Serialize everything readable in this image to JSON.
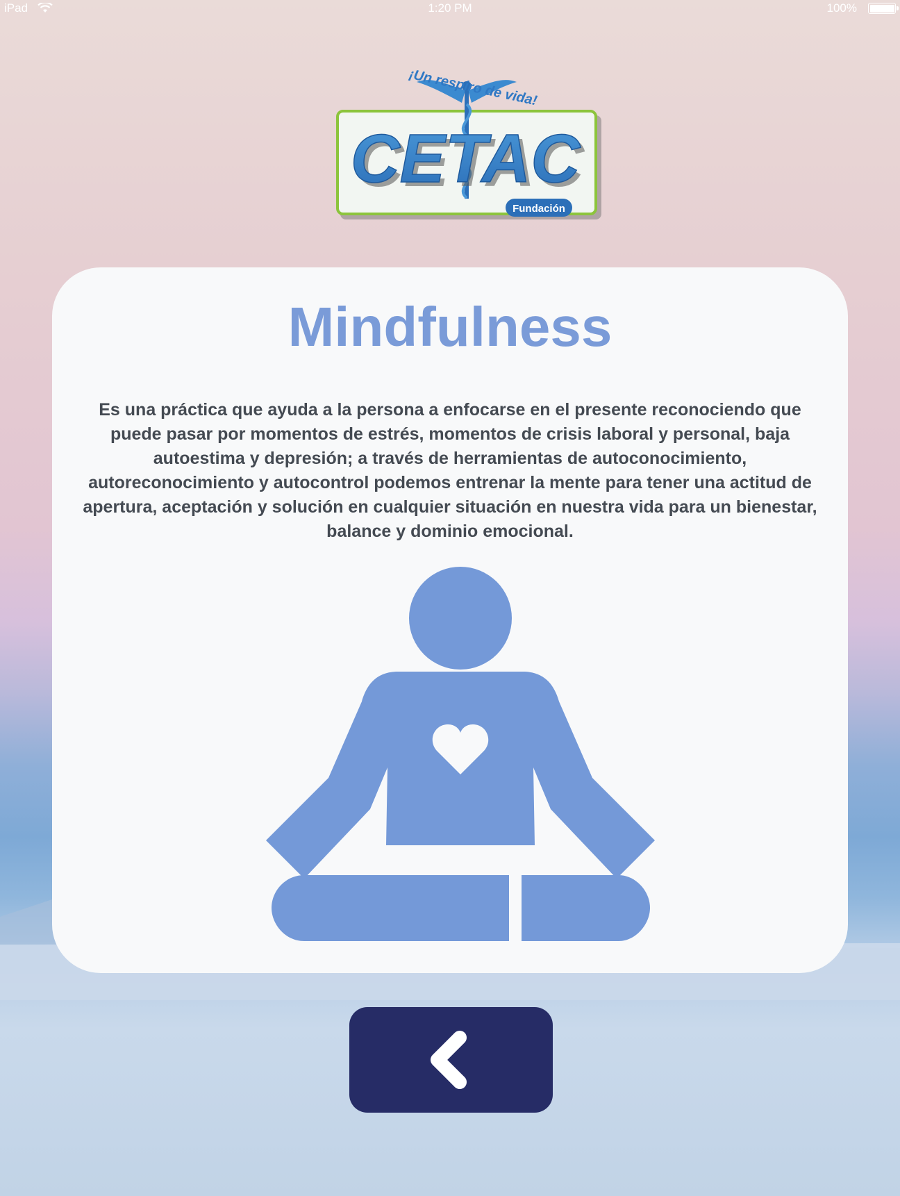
{
  "status_bar": {
    "device": "iPad",
    "time": "1:20 PM",
    "battery": "100%",
    "wifi_icon": "wifi-icon",
    "battery_icon": "battery-icon"
  },
  "logo": {
    "tagline": "¡Un respiro de vida!",
    "name": "CETAC",
    "subtitle": "Fundación"
  },
  "card": {
    "title": "Mindfulness",
    "body": "Es una práctica que ayuda a la persona a enfocarse en el presente reconociendo que puede pasar por momentos de estrés, momentos de crisis laboral y personal, baja autoestima y depresión; a través de herramientas de autoconocimiento, autoreconocimiento y autocontrol podemos entrenar la mente para tener una actitud de apertura, aceptación y solución en cualquier situación en nuestra vida para un bienestar, balance y dominio emocional.",
    "illustration": "meditation-icon"
  },
  "back_button": {
    "icon": "chevron-left-icon"
  },
  "colors": {
    "title": "#7a9bd8",
    "illustration": "#7499d8",
    "button": "#262c66",
    "card": "#f8f9fa",
    "text": "#444a52"
  }
}
